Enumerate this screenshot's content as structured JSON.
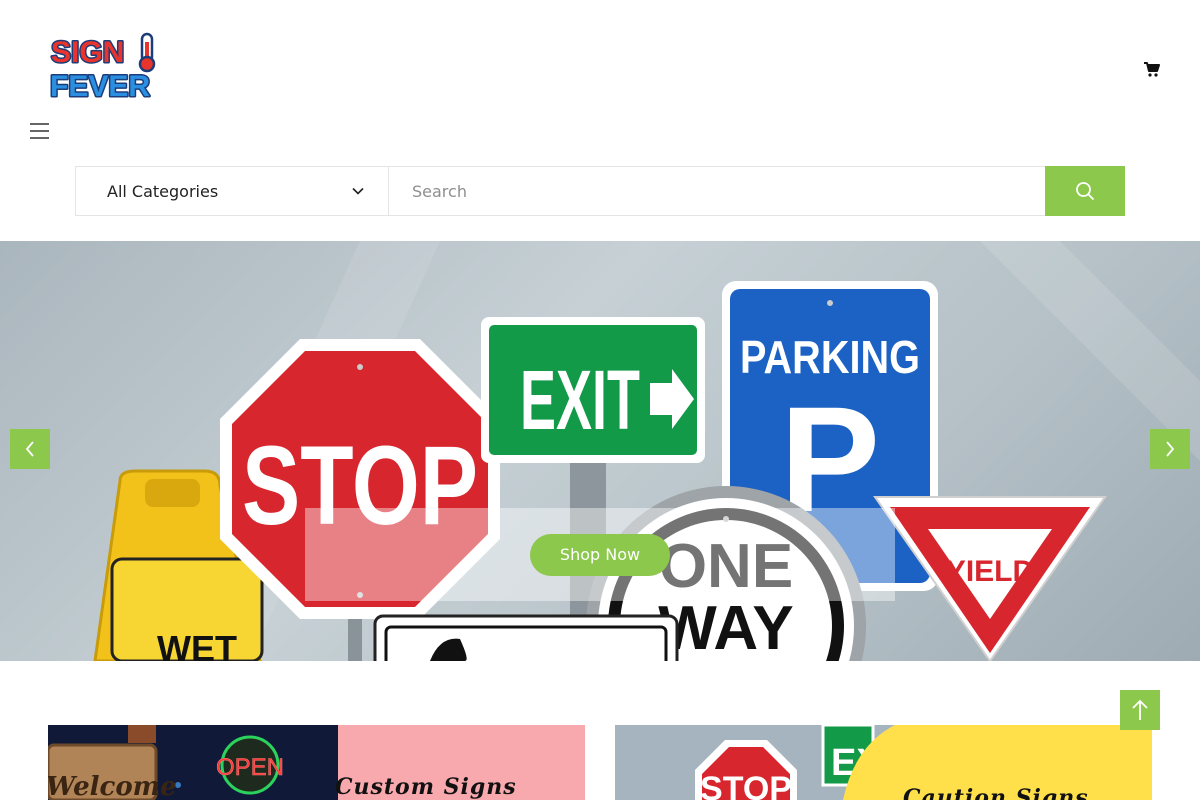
{
  "brand": {
    "logo_line1": "SIGN",
    "logo_line2": "FEVER"
  },
  "header": {
    "cart_icon": "cart-icon",
    "menu_icon": "hamburger-menu-icon"
  },
  "search": {
    "category_selected": "All Categories",
    "placeholder": "Search",
    "value": "",
    "button_icon": "search-icon"
  },
  "hero": {
    "cta_label": "Shop Now",
    "prev_icon": "chevron-left-icon",
    "next_icon": "chevron-right-icon",
    "sign_texts": {
      "stop": "STOP",
      "exit": "EXIT",
      "parking": "PARKING",
      "parking_letter": "P",
      "yield": "YIELD",
      "one_way_1": "ONE",
      "one_way_2": "WAY",
      "wet": "WET"
    }
  },
  "categories": [
    {
      "title": "Custom Signs",
      "sign_text_1": "Welcome",
      "sign_text_2": "OPEN"
    },
    {
      "title": "Caution Signs",
      "sign_text_1": "STOP",
      "sign_text_2": "EX"
    }
  ],
  "scroll_top_icon": "arrow-up-icon",
  "colors": {
    "accent": "#8cc84b",
    "card_pink": "#f7a9ad",
    "card_yellow": "#ffe04a",
    "stop_red": "#d7262d",
    "exit_green": "#139a49",
    "parking_blue": "#1c62c4"
  }
}
